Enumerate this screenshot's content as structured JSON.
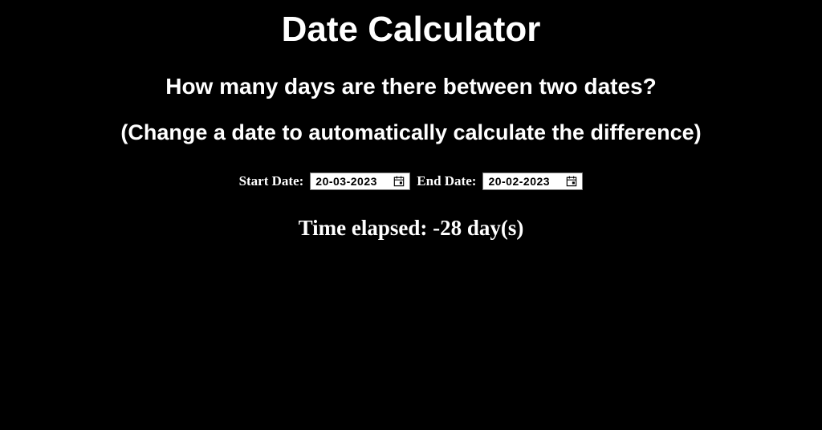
{
  "header": {
    "title": "Date Calculator",
    "subtitle": "How many days are there between two dates?",
    "instruction": "(Change a date to automatically calculate the difference)"
  },
  "form": {
    "start_label": "Start Date:",
    "start_value": "20-03-2023",
    "end_label": "End Date:",
    "end_value": "20-02-2023"
  },
  "result": {
    "text": "Time elapsed: -28 day(s)"
  }
}
